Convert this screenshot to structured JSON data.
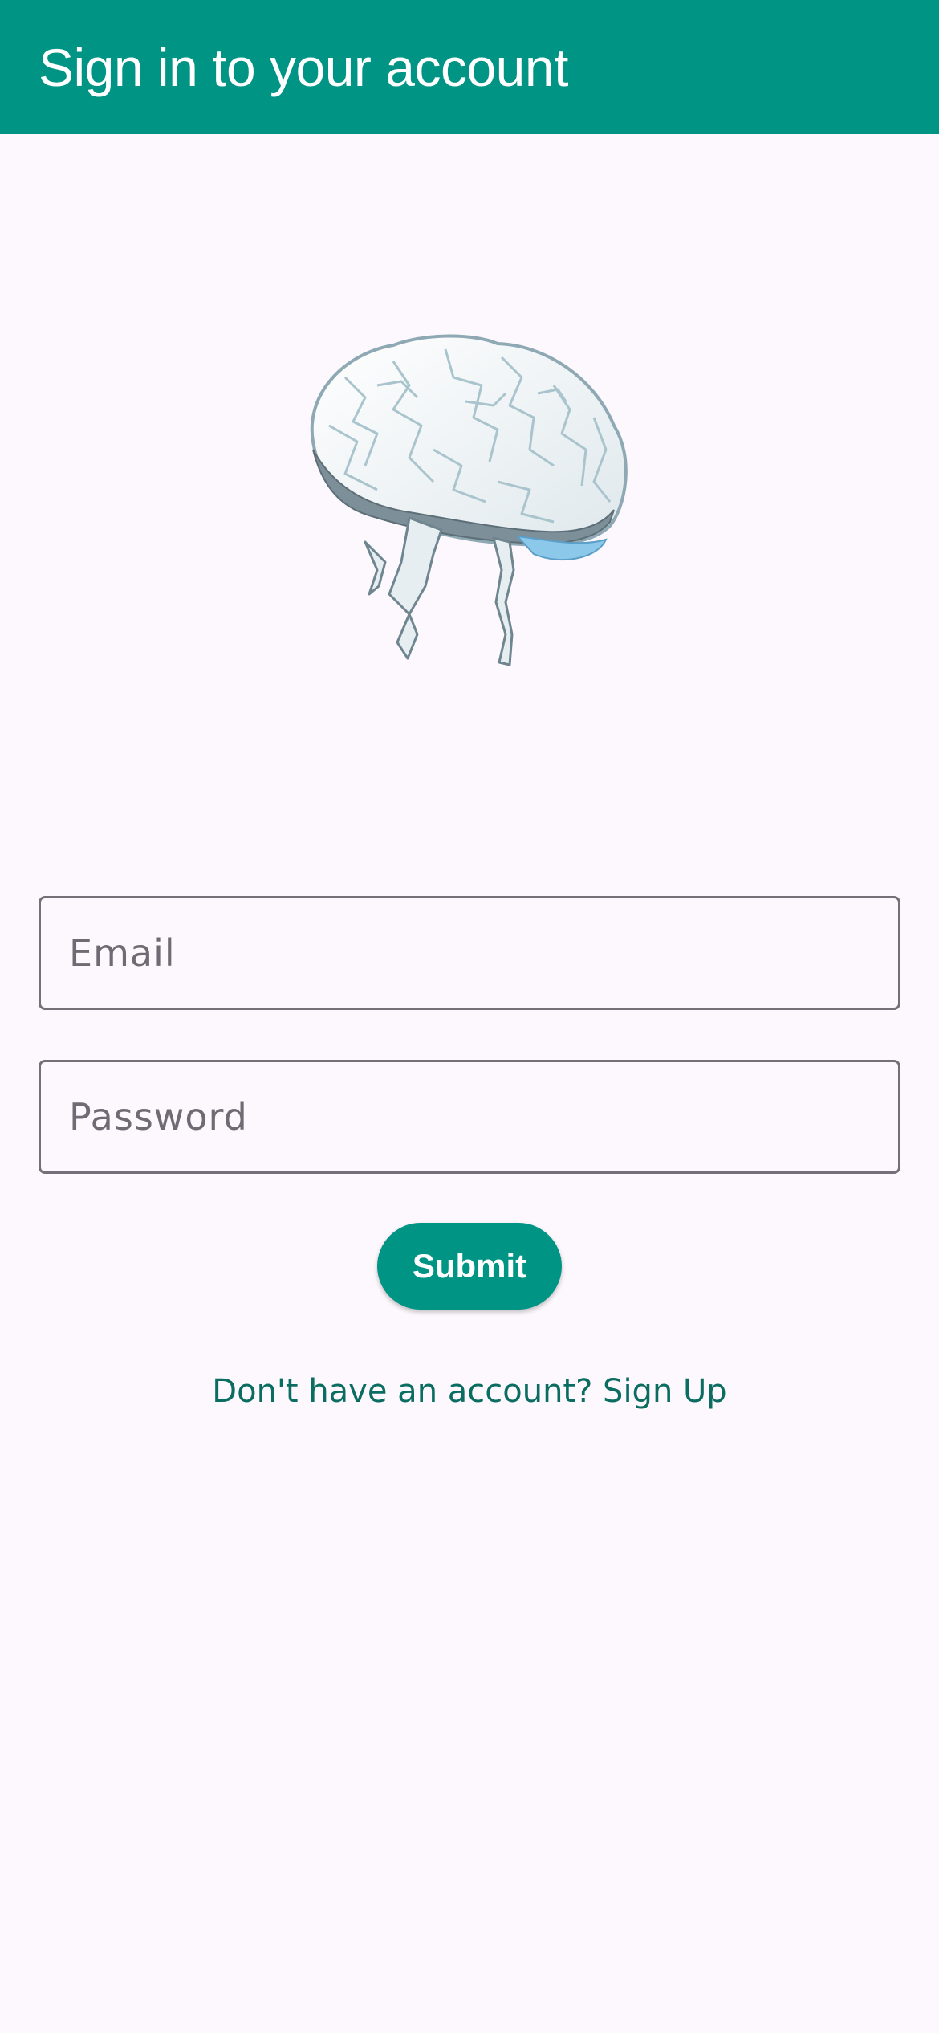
{
  "app_bar": {
    "title": "Sign in to your account",
    "background_color": "#009485"
  },
  "logo": {
    "icon": "brain-icon"
  },
  "form": {
    "email": {
      "value": "",
      "placeholder": "Email"
    },
    "password": {
      "value": "",
      "placeholder": "Password"
    },
    "submit_label": "Submit",
    "signup_link_text": "Don't have an account? Sign Up"
  },
  "colors": {
    "accent": "#009485",
    "link": "#0b6d62",
    "background": "#fdf8fd",
    "field_border": "#74707a"
  }
}
